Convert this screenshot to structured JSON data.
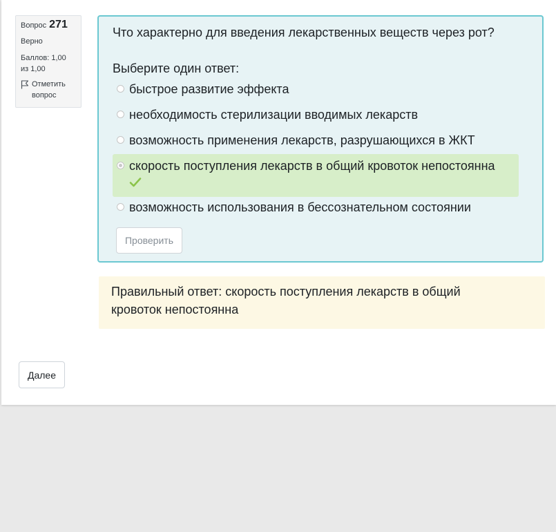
{
  "question_info": {
    "number_label": "Вопрос",
    "number": "271",
    "state": "Верно",
    "grade": "Баллов: 1,00 из 1,00",
    "flag_label": "Отметить вопрос"
  },
  "question": {
    "text": "Что характерно для введения лекарственных веществ через рот?",
    "prompt": "Выберите один ответ:",
    "options": [
      {
        "label": "быстрое развитие эффекта",
        "selected": false,
        "correct": false
      },
      {
        "label": "необходимость стерилизации вводимых лекарств",
        "selected": false,
        "correct": false
      },
      {
        "label": "возможность применения лекарств, разрушающихся в ЖКТ",
        "selected": false,
        "correct": false
      },
      {
        "label": "скорость поступления лекарств в общий кровоток непостоянна",
        "selected": true,
        "correct": true
      },
      {
        "label": "возможность использования в бессознательном состоянии",
        "selected": false,
        "correct": false
      }
    ],
    "check_button": "Проверить"
  },
  "feedback": {
    "right_answer": "Правильный ответ: скорость поступления лекарств в общий кровоток непостоянна"
  },
  "navigation": {
    "next_button": "Далее"
  },
  "colors": {
    "formulation_bg": "#e7f3f5",
    "formulation_border": "#6bc8d1",
    "correct_bg": "#d7eec9",
    "correct_icon": "#8bc34a",
    "feedback_bg": "#fdf8e4"
  },
  "icons": {
    "flag": "flag-icon",
    "correct": "check-icon"
  }
}
